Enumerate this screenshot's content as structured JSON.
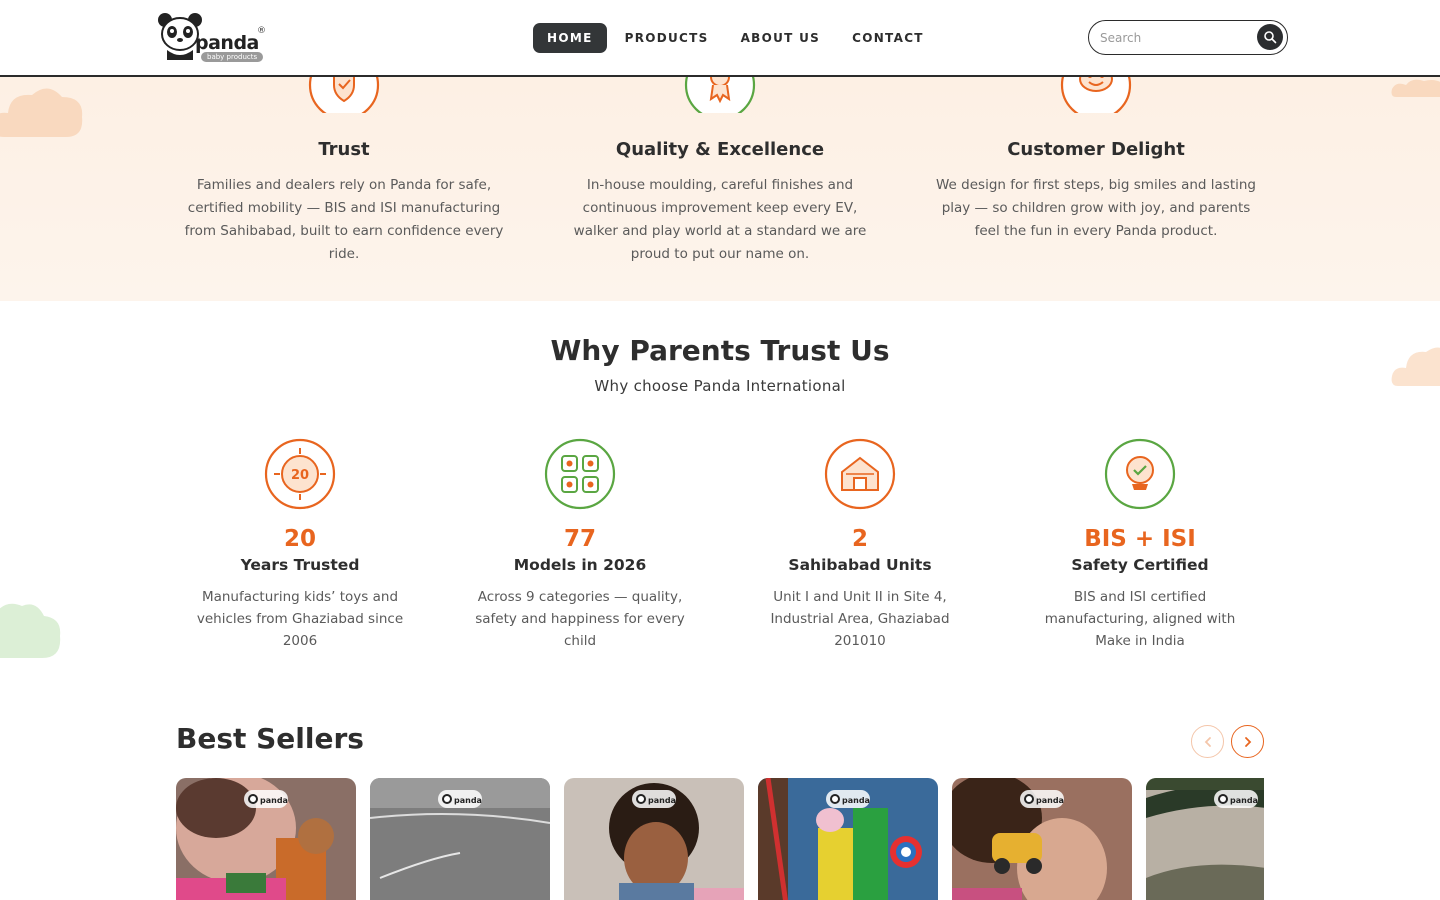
{
  "header": {
    "logo": {
      "name": "panda",
      "sub": "baby products",
      "reg": "®"
    },
    "nav": [
      {
        "label": "HOME",
        "active": true
      },
      {
        "label": "PRODUCTS",
        "active": false
      },
      {
        "label": "ABOUT US",
        "active": false
      },
      {
        "label": "CONTACT",
        "active": false
      }
    ],
    "search": {
      "placeholder": "Search",
      "value": ""
    }
  },
  "values": [
    {
      "title": "Trust",
      "icon": "shield-check-icon",
      "color": "#e8651f",
      "text": "Families and dealers rely on Panda for safe, certified mobility — BIS and ISI manufacturing from Sahibabad, built to earn confidence every ride."
    },
    {
      "title": "Quality & Excellence",
      "icon": "award-ribbon-icon",
      "color": "#5aa642",
      "text": "In-house moulding, careful finishes and continuous improvement keep every EV, walker and play world at a standard we are proud to put our name on."
    },
    {
      "title": "Customer Delight",
      "icon": "smiling-face-icon",
      "color": "#e8651f",
      "text": "We design for first steps, big smiles and lasting play — so children grow with joy, and parents feel the fun in every Panda product."
    }
  ],
  "why": {
    "title": "Why Parents Trust Us",
    "subtitle": "Why choose Panda International",
    "stats": [
      {
        "number": "20",
        "label": "Years Trusted",
        "icon": "anniversary-badge-icon",
        "icon_text": "20",
        "color": "#e8651f",
        "text": "Manufacturing kids’ toys and vehicles from Ghaziabad since 2006"
      },
      {
        "number": "77",
        "label": "Models in 2026",
        "icon": "grid-categories-icon",
        "color": "#5aa642",
        "text": "Across 9 categories — quality, safety and happiness for every child"
      },
      {
        "number": "2",
        "label": "Sahibabad Units",
        "icon": "factory-building-icon",
        "color": "#e8651f",
        "text": "Unit I and Unit II in Site 4, Industrial Area, Ghaziabad 201010"
      },
      {
        "number": "BIS + ISI",
        "label": "Safety Certified",
        "icon": "certified-medal-icon",
        "color": "#5aa642",
        "text": "BIS and ISI certified manufacturing, aligned with Make in India"
      }
    ]
  },
  "best_sellers": {
    "title": "Best Sellers",
    "prev_icon": "chevron-left-icon",
    "next_icon": "chevron-right-icon",
    "cards": [
      {
        "scene": "child-playing-with-blocks"
      },
      {
        "scene": "outdoor-playground-tarmac"
      },
      {
        "scene": "smiling-child"
      },
      {
        "scene": "playground-slide"
      },
      {
        "scene": "child-with-toy-car"
      },
      {
        "scene": "outdoor-landscape"
      }
    ],
    "badge_text": "panda"
  },
  "colors": {
    "accent": "#e8651f",
    "green": "#5aa642",
    "dark": "#2e2e2e",
    "cream": "#fdf0e4"
  }
}
